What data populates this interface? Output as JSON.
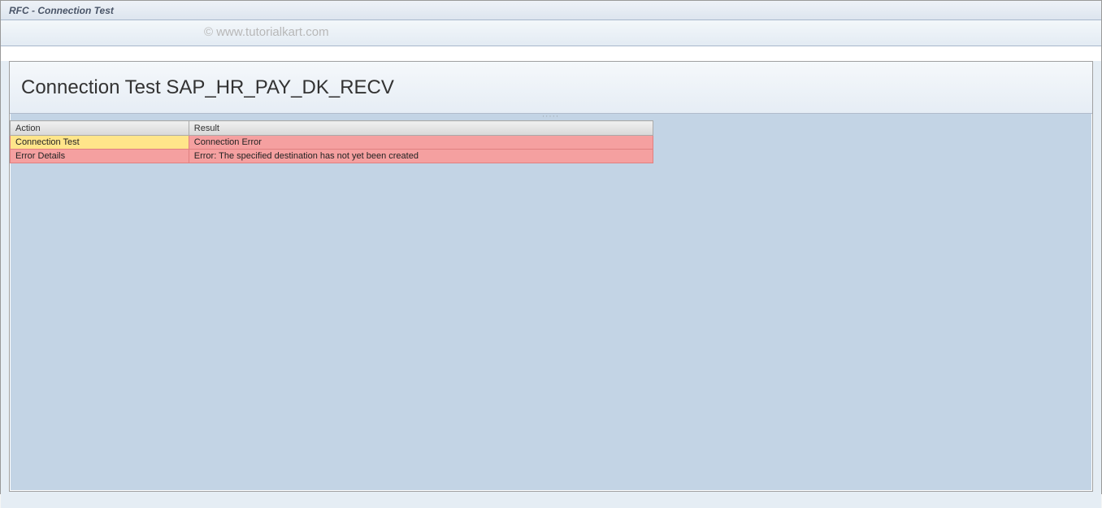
{
  "window": {
    "title": "RFC - Connection Test"
  },
  "watermark": "© www.tutorialkart.com",
  "panel": {
    "heading": "Connection Test SAP_HR_PAY_DK_RECV"
  },
  "table": {
    "headers": {
      "action": "Action",
      "result": "Result"
    },
    "rows": [
      {
        "action": "Connection Test",
        "action_class": "cell-yellow",
        "result": "Connection Error",
        "result_class": "cell-red"
      },
      {
        "action": "Error Details",
        "action_class": "cell-red",
        "result": "Error: The specified destination has not yet been created",
        "result_class": "cell-red"
      }
    ]
  }
}
